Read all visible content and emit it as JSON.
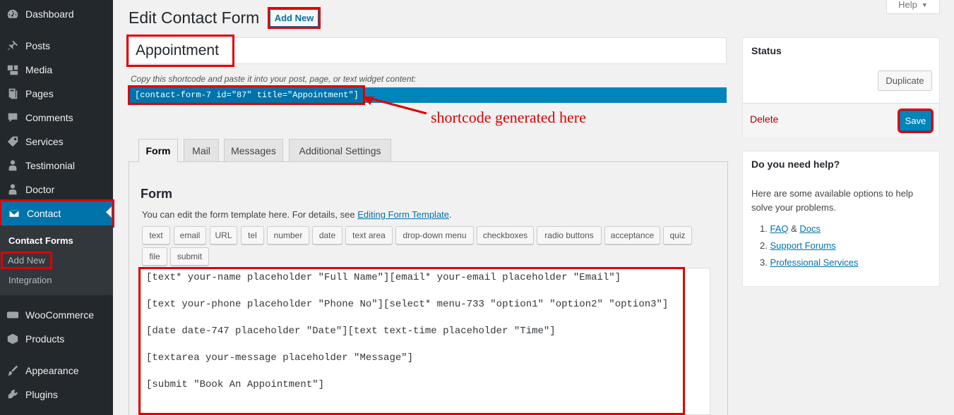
{
  "sidebar": {
    "items": [
      {
        "label": "Dashboard",
        "icon": "dashboard-icon"
      },
      {
        "label": "Posts",
        "icon": "pin-icon"
      },
      {
        "label": "Media",
        "icon": "media-icon"
      },
      {
        "label": "Pages",
        "icon": "pages-icon"
      },
      {
        "label": "Comments",
        "icon": "comment-icon"
      },
      {
        "label": "Services",
        "icon": "tag-icon"
      },
      {
        "label": "Testimonial",
        "icon": "person-icon"
      },
      {
        "label": "Doctor",
        "icon": "person-icon"
      },
      {
        "label": "Contact",
        "icon": "envelope-icon"
      },
      {
        "label": "WooCommerce",
        "icon": "woo-icon"
      },
      {
        "label": "Products",
        "icon": "box-icon"
      },
      {
        "label": "Appearance",
        "icon": "brush-icon"
      },
      {
        "label": "Plugins",
        "icon": "plug-icon"
      }
    ],
    "submenu": [
      "Contact Forms",
      "Add New",
      "Integration"
    ]
  },
  "header": {
    "title": "Edit Contact Form",
    "add_new": "Add New",
    "help": "Help"
  },
  "form_title": "Appointment",
  "shortcode": {
    "hint": "Copy this shortcode and paste it into your post, page, or text widget content:",
    "code": "[contact-form-7 id=\"87\" title=\"Appointment\"]"
  },
  "annotation": "shortcode generated here",
  "tabs": [
    "Form",
    "Mail",
    "Messages",
    "Additional Settings"
  ],
  "form_panel": {
    "heading": "Form",
    "desc_prefix": "You can edit the form template here. For details, see ",
    "desc_link": "Editing Form Template",
    "desc_suffix": ".",
    "tag_buttons": [
      "text",
      "email",
      "URL",
      "tel",
      "number",
      "date",
      "text area",
      "drop-down menu",
      "checkboxes",
      "radio buttons",
      "acceptance",
      "quiz",
      "file",
      "submit"
    ],
    "code_lines": [
      "[text* your-name placeholder \"Full Name\"][email* your-email placeholder \"Email\"]",
      "[text your-phone placeholder \"Phone No\"][select* menu-733 \"option1\" \"option2\" \"option3\"]",
      "[date date-747 placeholder \"Date\"][text text-time placeholder \"Time\"]",
      "[textarea your-message placeholder \"Message\"]",
      "[submit \"Book An Appointment\"]"
    ]
  },
  "status_box": {
    "title": "Status",
    "duplicate": "Duplicate",
    "delete": "Delete",
    "save": "Save"
  },
  "help_box": {
    "title": "Do you need help?",
    "text": "Here are some available options to help solve your problems.",
    "items": [
      {
        "num": "1.",
        "link1": "FAQ",
        "amp": " & ",
        "link2": "Docs"
      },
      {
        "num": "2.",
        "link1": "Support Forums"
      },
      {
        "num": "3.",
        "link1": "Professional Services"
      }
    ]
  },
  "colors": {
    "sidebar_bg": "#23282d",
    "accent": "#0073aa",
    "annotation_red": "#e00000"
  }
}
